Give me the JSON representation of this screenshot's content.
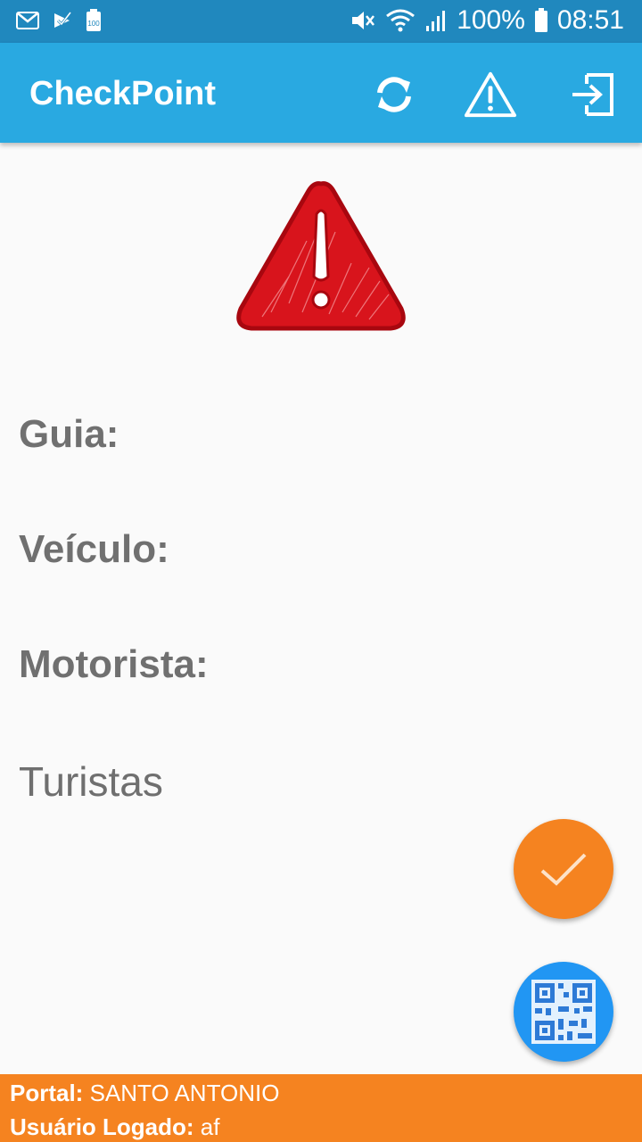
{
  "status_bar": {
    "battery_percent": "100%",
    "time": "08:51",
    "icons": [
      "gmail-icon",
      "check-notification-icon",
      "battery-saver-icon",
      "mute-icon",
      "wifi-icon",
      "signal-icon",
      "battery-icon"
    ]
  },
  "app_bar": {
    "title": "CheckPoint",
    "actions": [
      "refresh-icon",
      "warning-icon",
      "logout-icon"
    ]
  },
  "main": {
    "alert_icon": "warning-triangle-icon",
    "guia_label": "Guia:",
    "veiculo_label": "Veículo:",
    "motorista_label": "Motorista:",
    "turistas_label": "Turistas"
  },
  "fabs": {
    "confirm_icon": "checkmark-icon",
    "scan_icon": "qr-code-icon"
  },
  "footer": {
    "portal_label": "Portal:",
    "portal_value": "SANTO ANTONIO",
    "user_label": "Usuário Logado:",
    "user_value": "af"
  },
  "colors": {
    "status_bar": "#2088be",
    "app_bar": "#29a9e1",
    "footer": "#f58320",
    "fab_confirm": "#f58320",
    "fab_scan": "#2196f3",
    "alert_red": "#d8141c"
  }
}
